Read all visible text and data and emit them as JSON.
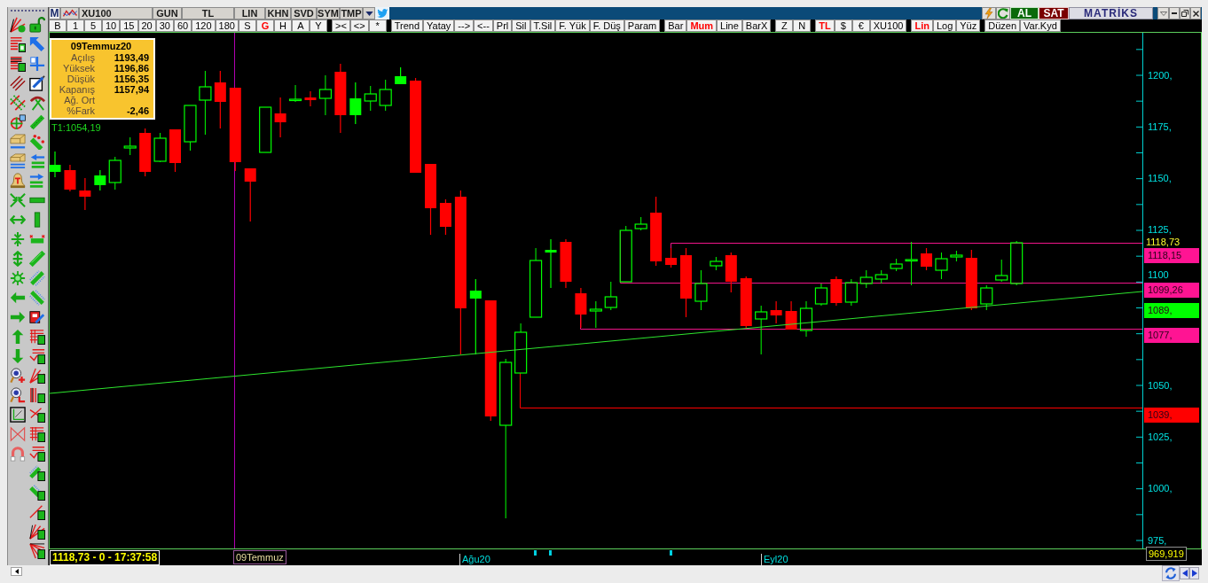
{
  "top_bar": {
    "menu": "M",
    "symbol": "XU100",
    "buttons": [
      "GUN",
      "TL",
      "LIN",
      "KHN",
      "SVD",
      "SYM",
      "TMP"
    ],
    "buy": "AL",
    "sell": "SAT",
    "brand": "MATRİKS"
  },
  "chart_toolbar": {
    "periods": [
      {
        "label": "B",
        "selected": false
      },
      {
        "label": "1",
        "selected": false
      },
      {
        "label": "5",
        "selected": false
      },
      {
        "label": "10",
        "selected": false
      },
      {
        "label": "15",
        "selected": false
      },
      {
        "label": "20",
        "selected": false
      },
      {
        "label": "30",
        "selected": false
      },
      {
        "label": "60",
        "selected": false
      },
      {
        "label": "120",
        "selected": false
      },
      {
        "label": "180",
        "selected": false
      },
      {
        "label": "S",
        "selected": false
      },
      {
        "label": "G",
        "selected": true
      },
      {
        "label": "H",
        "selected": false
      },
      {
        "label": "A",
        "selected": false
      },
      {
        "label": "Y",
        "selected": false
      }
    ],
    "zoom": [
      "><",
      "<>",
      "*"
    ],
    "drawing": [
      "Trend",
      "Yatay",
      "-->",
      "<--",
      "Prl",
      "Sil",
      "T.Sil",
      "F. Yük",
      "F. Düş",
      "Param"
    ],
    "chart_types": [
      {
        "label": "Bar",
        "selected": false
      },
      {
        "label": "Mum",
        "selected": true
      },
      {
        "label": "Line",
        "selected": false
      },
      {
        "label": "BarX",
        "selected": false
      }
    ],
    "zn": [
      "Z",
      "N"
    ],
    "currencies": [
      {
        "label": "TL",
        "selected": true
      },
      {
        "label": "$",
        "selected": false
      },
      {
        "label": "€",
        "selected": false
      },
      {
        "label": "XU100",
        "selected": false
      }
    ],
    "scales": [
      {
        "label": "Lin",
        "selected": true
      },
      {
        "label": "Log",
        "selected": false
      },
      {
        "label": "Yüz",
        "selected": false
      }
    ],
    "layout": [
      "Düzen",
      "Var.Kyd"
    ]
  },
  "info_box": {
    "title": "09Temmuz20",
    "rows": [
      {
        "label": "Açılış",
        "value": "1193,49"
      },
      {
        "label": "Yüksek",
        "value": "1196,86"
      },
      {
        "label": "Düşük",
        "value": "1156,35"
      },
      {
        "label": "Kapanış",
        "value": "1157,94"
      },
      {
        "label": "Ağ. Ort"
      },
      {
        "label": "%Fark",
        "value": "-2,46"
      }
    ]
  },
  "trend_label": "T1:1054,19",
  "price_axis": {
    "labels": [
      "1200,",
      "1175,",
      "1150,",
      "1125,",
      "1100",
      "1050,",
      "1025,",
      "1000,",
      "975,"
    ],
    "last_price": "1118,73",
    "tags": [
      {
        "text": "1118,15",
        "color": "#ff1493"
      },
      {
        "text": "1099,26",
        "color": "#ff1493"
      },
      {
        "text": "1089,",
        "color": "#00ff00"
      },
      {
        "text": "1077,",
        "color": "#ff1493"
      },
      {
        "text": "1039,",
        "color": "#ff0000"
      }
    ],
    "cursor_price": "969,919"
  },
  "time_axis": {
    "status": "1118,73 - 0 - 17:37:58",
    "cursor_date": "09Temmuz",
    "labels": [
      "Ağu20",
      "Eyl20"
    ]
  }
}
